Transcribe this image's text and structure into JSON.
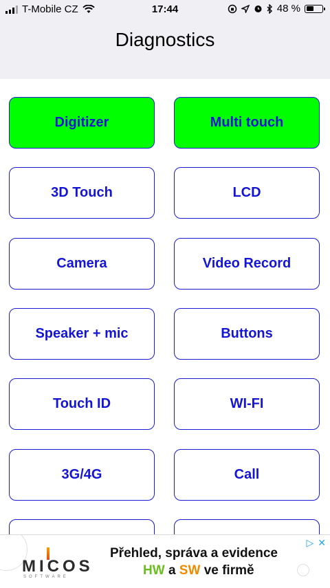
{
  "status_bar": {
    "carrier": "T-Mobile CZ",
    "time": "17:44",
    "battery_percent": "48 %",
    "battery_level": 0.48
  },
  "nav": {
    "title": "Diagnostics"
  },
  "buttons": [
    {
      "label": "Digitizer",
      "done": true
    },
    {
      "label": "Multi touch",
      "done": true
    },
    {
      "label": "3D Touch",
      "done": false
    },
    {
      "label": "LCD",
      "done": false
    },
    {
      "label": "Camera",
      "done": false
    },
    {
      "label": "Video Record",
      "done": false
    },
    {
      "label": "Speaker + mic",
      "done": false
    },
    {
      "label": "Buttons",
      "done": false
    },
    {
      "label": "Touch ID",
      "done": false
    },
    {
      "label": "WI-FI",
      "done": false
    },
    {
      "label": "3G/4G",
      "done": false
    },
    {
      "label": "Call",
      "done": false
    },
    {
      "label": "",
      "done": false
    },
    {
      "label": "",
      "done": false
    }
  ],
  "ad": {
    "logo": "MICOS",
    "logo_sub": "SOFTWARE",
    "headline": "Přehled, správa a evidence",
    "tagline_hw": "HW",
    "tagline_a": "a",
    "tagline_sw": "SW",
    "tagline_rest": "ve firmě",
    "play_icon": "▷",
    "close_icon": "✕"
  },
  "colors": {
    "accent": "#1414d4",
    "done_fill": "#00ff00",
    "nav_bg": "#efeff4"
  }
}
